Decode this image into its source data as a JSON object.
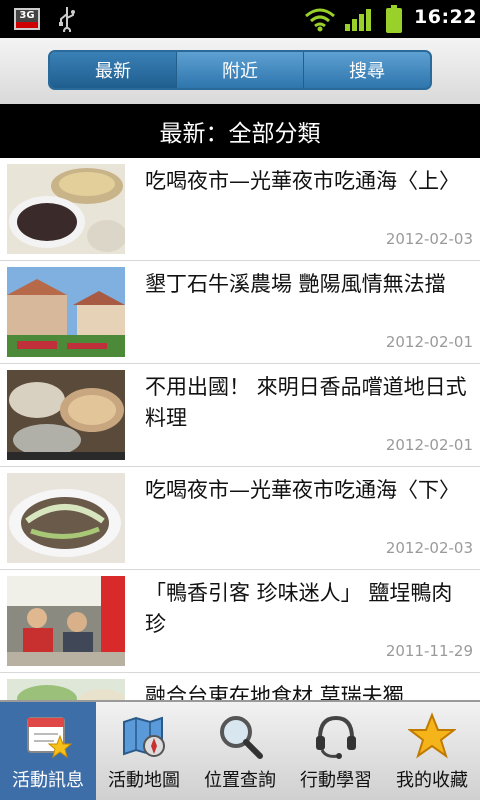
{
  "status_bar": {
    "network_badge": "3G",
    "time": "16:22",
    "icons": [
      "3g-icon",
      "usb-icon",
      "wifi-icon",
      "signal-icon",
      "battery-icon"
    ]
  },
  "tabs": [
    {
      "label": "最新",
      "selected": true
    },
    {
      "label": "附近",
      "selected": false
    },
    {
      "label": "搜尋",
      "selected": false
    }
  ],
  "category_header": "最新：全部分類",
  "list": [
    {
      "title": "吃喝夜市—光華夜市吃通海〈上〉",
      "date": "2012-02-03",
      "thumb": "food-photo"
    },
    {
      "title": "墾丁石牛溪農場 艷陽風情無法擋",
      "date": "2012-02-01",
      "thumb": "farm-photo"
    },
    {
      "title": "不用出國！ 來明日香品嚐道地日式料理",
      "date": "2012-02-01",
      "thumb": "japanese-food-photo"
    },
    {
      "title": "吃喝夜市—光華夜市吃通海〈下〉",
      "date": "2012-02-03",
      "thumb": "food-photo"
    },
    {
      "title": "「鴨香引客 珍味迷人」 鹽埕鴨肉珍",
      "date": "2011-11-29",
      "thumb": "shop-photo"
    },
    {
      "title": "融合台東在地食材 莫瑞夫獨",
      "date": "",
      "thumb": "food-photo"
    }
  ],
  "bottom_nav": [
    {
      "label": "活動訊息",
      "icon": "calendar-star-icon",
      "active": true
    },
    {
      "label": "活動地圖",
      "icon": "map-compass-icon",
      "active": false
    },
    {
      "label": "位置查詢",
      "icon": "magnifier-icon",
      "active": false
    },
    {
      "label": "行動學習",
      "icon": "headset-icon",
      "active": false
    },
    {
      "label": "我的收藏",
      "icon": "star-icon",
      "active": false
    }
  ],
  "colors": {
    "tab_blue": "#2e76ad",
    "active_nav": "#3e6ea8",
    "date_gray": "#9a9a9a"
  }
}
